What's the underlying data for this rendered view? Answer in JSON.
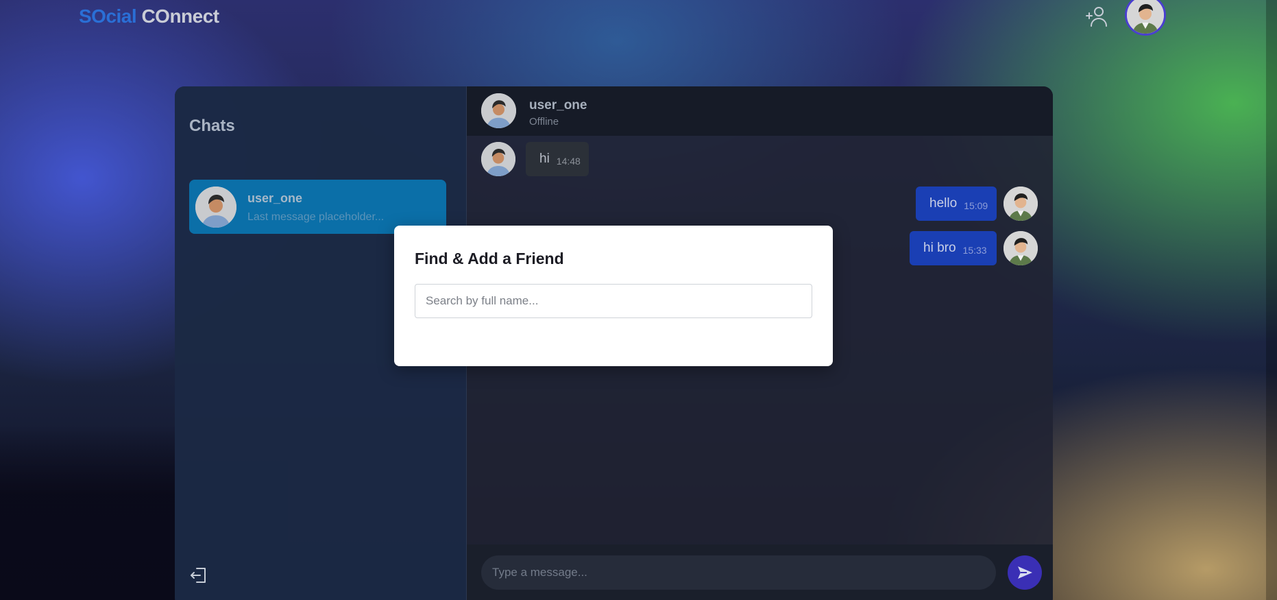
{
  "header": {
    "logo_part1": "SOcial",
    "logo_part2": " COnnect",
    "add_friend_icon": "user-plus-icon",
    "profile_icon": "avatar"
  },
  "sidebar": {
    "title": "Chats",
    "chats": [
      {
        "name": "user_one",
        "preview": "Last message placeholder..."
      }
    ],
    "logout_icon": "logout-icon"
  },
  "conversation": {
    "contact_name": "user_one",
    "contact_status": "Offline",
    "messages": [
      {
        "direction": "in",
        "text": "hi",
        "time": "14:48"
      },
      {
        "direction": "out",
        "text": "hello",
        "time": "15:09"
      },
      {
        "direction": "out",
        "text": "hi bro",
        "time": "15:33"
      }
    ],
    "composer_placeholder": "Type a message...",
    "send_icon": "send-icon"
  },
  "modal": {
    "title": "Find & Add a Friend",
    "search_placeholder": "Search by full name..."
  },
  "colors": {
    "accent": "#1a3fb4",
    "active_chat": "#0b6fa8",
    "send_button": "#3a2fb5",
    "logo_blue": "#2a6fd6"
  }
}
